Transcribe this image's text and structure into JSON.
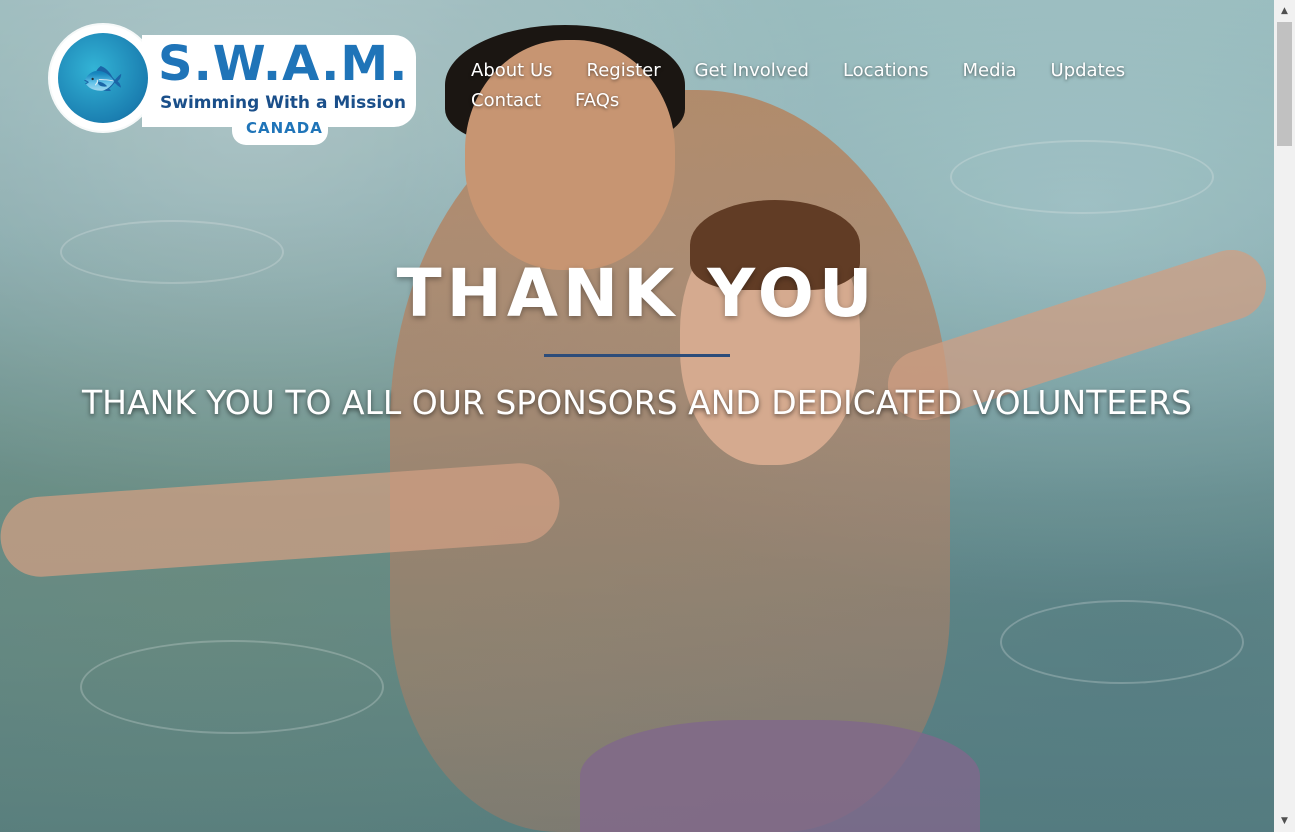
{
  "logo": {
    "icon": "fish-icon",
    "title": "S.W.A.M.",
    "subtitle": "Swimming With a Mission",
    "country": "CANADA"
  },
  "nav": {
    "row1": [
      "About Us",
      "Register",
      "Get Involved",
      "Locations",
      "Media",
      "Updates"
    ],
    "row2": [
      "Contact",
      "FAQs"
    ]
  },
  "hero": {
    "title": "THANK YOU",
    "subtitle": "THANK YOU TO ALL OUR SPONSORS AND DEDICATED VOLUNTEERS",
    "image": "swimmers-in-pool-photo"
  },
  "scrollbar": {
    "up_icon": "▲",
    "down_icon": "▼"
  }
}
